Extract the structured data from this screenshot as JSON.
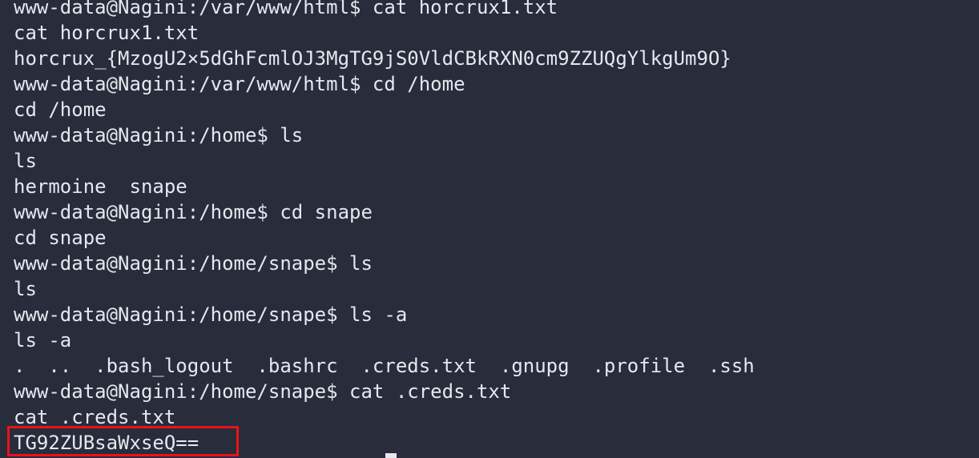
{
  "terminal": {
    "lines": [
      "www-data@Nagini:/var/www/html$ cat horcrux1.txt",
      "cat horcrux1.txt",
      "horcrux_{MzogU2×5dGhFcmlOJ3MgTG9jS0VldCBkRXN0cm9ZZUQgYlkgUm9O}",
      "www-data@Nagini:/var/www/html$ cd /home",
      "cd /home",
      "www-data@Nagini:/home$ ls",
      "ls",
      "hermoine  snape",
      "www-data@Nagini:/home$ cd snape",
      "cd snape",
      "www-data@Nagini:/home/snape$ ls",
      "ls",
      "www-data@Nagini:/home/snape$ ls -a",
      "ls -a",
      ".  ..  .bash_logout  .bashrc  .creds.txt  .gnupg  .profile  .ssh",
      "www-data@Nagini:/home/snape$ cat .creds.txt",
      "cat .creds.txt",
      "TG92ZUBsaWxseQ=="
    ]
  },
  "colors": {
    "background": "#282c3b",
    "text": "#e6e8ee",
    "highlight_border": "#e8131b"
  }
}
